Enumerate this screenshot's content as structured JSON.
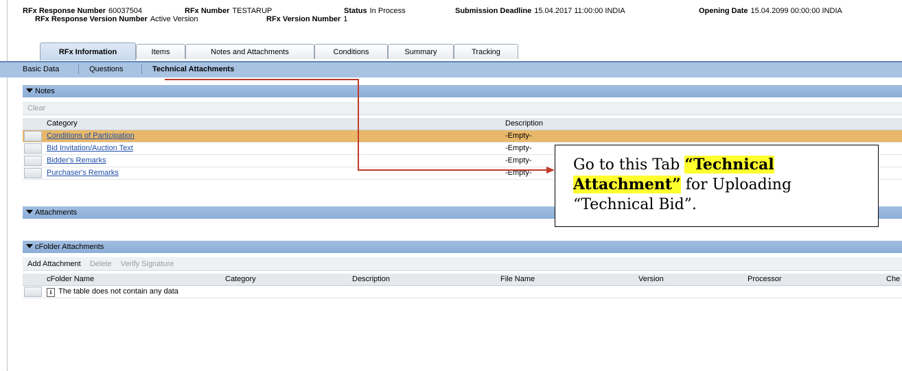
{
  "header": {
    "response_number_label": "RFx Response Number",
    "response_number": "60037504",
    "rfx_number_label": "RFx Number",
    "rfx_number": "TESTARUP",
    "status_label": "Status",
    "status": "In Process",
    "deadline_label": "Submission Deadline",
    "deadline": "15.04.2017 11:00:00 INDIA",
    "opening_label": "Opening Date",
    "opening": "15.04.2099 00:00:00 INDIA",
    "response_version_label": "RFx Response Version Number",
    "response_version": "Active Version",
    "rfx_version_label": "RFx Version Number",
    "rfx_version": "1"
  },
  "tabs": [
    "RFx Information",
    "Items",
    "Notes and Attachments",
    "Conditions",
    "Summary",
    "Tracking"
  ],
  "subnav": [
    "Basic Data",
    "Questions",
    "Technical Attachments"
  ],
  "notes": {
    "title": "Notes",
    "clear_label": "Clear",
    "columns": [
      "Category",
      "Description"
    ],
    "rows": [
      {
        "category": "Conditions of Participation",
        "description": "-Empty-"
      },
      {
        "category": "Bid Invitation/Auction Text",
        "description": "-Empty-"
      },
      {
        "category": "Bidder's Remarks",
        "description": "-Empty-"
      },
      {
        "category": "Purchaser's Remarks",
        "description": "-Empty-"
      }
    ]
  },
  "attachments": {
    "title": "Attachments"
  },
  "cfolder": {
    "title": "cFolder Attachments",
    "add_label": "Add Attachment",
    "delete_label": "Delete",
    "verify_label": "Verify Signature",
    "columns": [
      "cFolder Name",
      "Category",
      "Description",
      "File Name",
      "Version",
      "Processor",
      "Che"
    ],
    "empty_text": "The table does not contain any data"
  },
  "callout": {
    "part1": "Go to this Tab ",
    "highlight1": "“Technical",
    "highlight2": "Attachment”",
    "part2": " for Uploading",
    "part3": "“Technical Bid”."
  },
  "colors": {
    "accent": "#a8c3e2",
    "selected_row": "#e8b86a",
    "arrow": "#c0392b",
    "highlight": "#ffff2e"
  }
}
